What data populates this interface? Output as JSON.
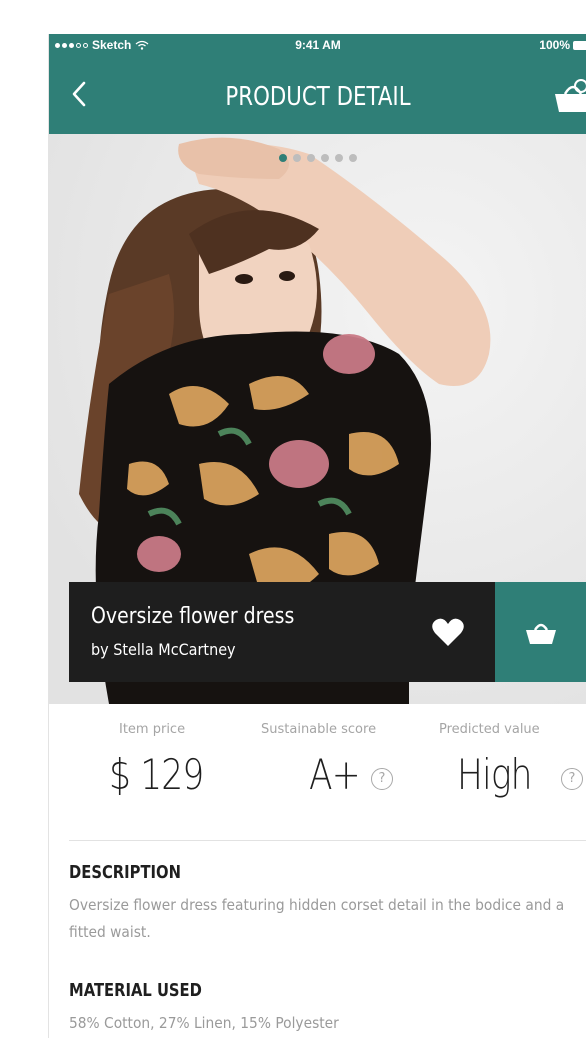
{
  "status_bar": {
    "carrier": "Sketch",
    "time": "9:41 AM",
    "battery": "100%"
  },
  "nav": {
    "title": "PRODUCT DETAIL",
    "back_icon": "chevron-left-icon",
    "cart_icon": "shopping-basket-icon"
  },
  "gallery": {
    "page_count": 6,
    "active_page": 1
  },
  "product": {
    "name": "Oversize flower dress",
    "brand": "by Stella McCartney"
  },
  "metrics": [
    {
      "label": "Item price",
      "value": "$ 129"
    },
    {
      "label": "Sustainable score",
      "value": "A+"
    },
    {
      "label": "Predicted value",
      "value": "High"
    }
  ],
  "help_glyph": "?",
  "description": {
    "heading": "DESCRIPTION",
    "text": "Oversize flower dress featuring hidden corset detail in the bodice and a fitted waist."
  },
  "material": {
    "heading": "MATERIAL USED",
    "text": "58% Cotton, 27% Linen, 15% Polyester"
  },
  "colors": {
    "accent": "#2f7f77",
    "dark_bar": "#1e1e1e"
  }
}
